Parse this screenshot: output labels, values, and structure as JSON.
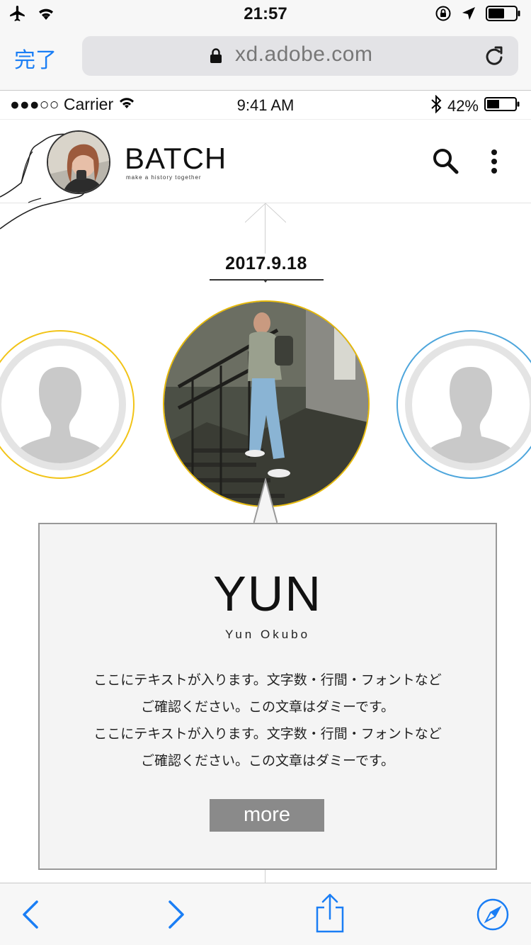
{
  "os_status": {
    "time": "21:57",
    "icons": [
      "airplane-icon",
      "wifi-icon",
      "rotation-lock-icon",
      "location-icon",
      "battery-icon"
    ]
  },
  "safari": {
    "done_label": "完了",
    "url": "xd.adobe.com",
    "icons": [
      "lock-icon",
      "reload-icon"
    ]
  },
  "mock_status": {
    "carrier": "●●●○○ Carrier",
    "time": "9:41 AM",
    "battery": "42%",
    "icons": [
      "wifi-icon",
      "bluetooth-icon",
      "battery-icon"
    ]
  },
  "app_header": {
    "brand": "BATCH",
    "tagline": "make a history together",
    "icons": [
      "search-icon",
      "more-vertical-icon"
    ]
  },
  "timeline": {
    "date": "2017.9.18",
    "left_ring_color": "#f2c418",
    "right_ring_color": "#4ea6dc",
    "main_ring_color": "#e6b90a"
  },
  "card": {
    "name": "YUN",
    "subtitle": "Yun Okubo",
    "lines": [
      "ここにテキストが入ります。文字数・行間・フォントなど",
      "ご確認ください。この文章はダミーです。",
      "ここにテキストが入ります。文字数・行間・フォントなど",
      "ご確認ください。この文章はダミーです。"
    ],
    "more_label": "more"
  },
  "toolbar": {
    "icons": [
      "back-icon",
      "forward-icon",
      "share-icon",
      "compass-icon"
    ],
    "accent": "#1a7ef5"
  }
}
